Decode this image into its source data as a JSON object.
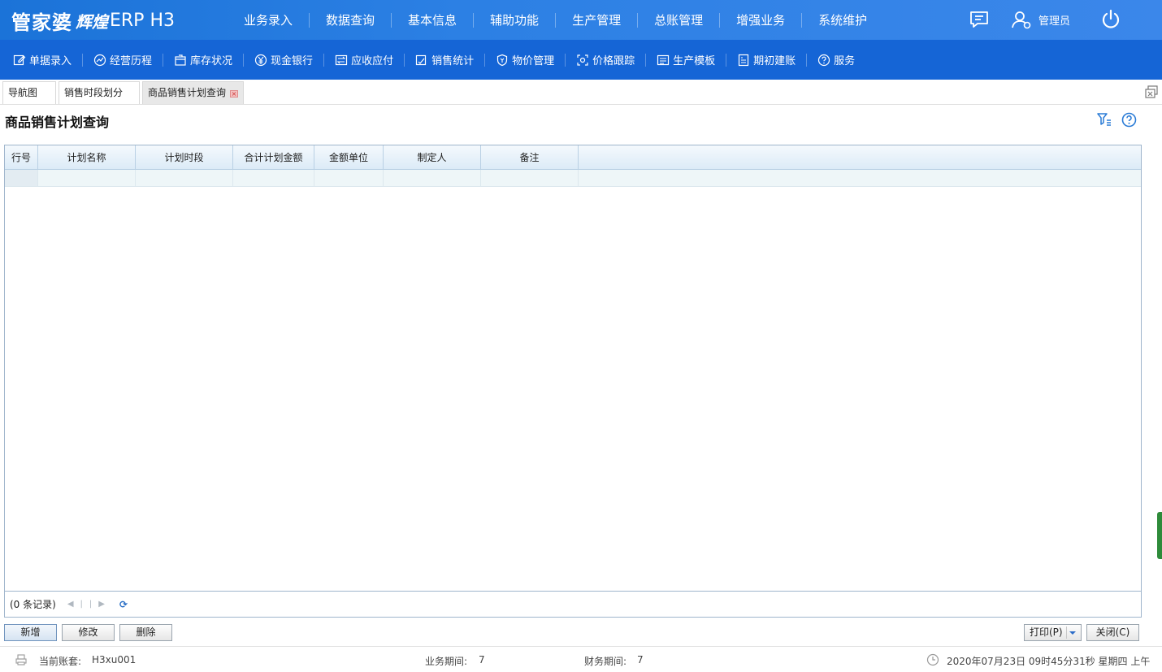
{
  "app": {
    "brand": "管家婆",
    "sub": "辉煌",
    "product": "ERP H3"
  },
  "topnav": {
    "items": [
      "业务录入",
      "数据查询",
      "基本信息",
      "辅助功能",
      "生产管理",
      "总账管理",
      "增强业务",
      "系统维护"
    ],
    "user": "管理员"
  },
  "toolbar": {
    "items": [
      "单据录入",
      "经营历程",
      "库存状况",
      "现金银行",
      "应收应付",
      "销售统计",
      "物价管理",
      "价格跟踪",
      "生产模板",
      "期初建账",
      "服务"
    ]
  },
  "tabs": [
    {
      "label": "导航图"
    },
    {
      "label": "销售时段划分"
    },
    {
      "label": "商品销售计划查询"
    }
  ],
  "page": {
    "title": "商品销售计划查询"
  },
  "grid": {
    "columns": [
      "行号",
      "计划名称",
      "计划时段",
      "合计计划金额",
      "金额单位",
      "制定人",
      "备注"
    ],
    "record_count": "(0 条记录)"
  },
  "buttons": {
    "add": "新增",
    "edit": "修改",
    "delete": "删除",
    "print": "打印(P)",
    "close": "关闭(C)"
  },
  "status": {
    "account_label": "当前账套:",
    "account_value": "H3xu001",
    "biz_period_label": "业务期间:",
    "biz_period_value": "7",
    "fin_period_label": "财务期间:",
    "fin_period_value": "7",
    "datetime": "2020年07月23日 09时45分31秒 星期四 上午"
  },
  "colors": {
    "topbar": "#2c80e4",
    "toolbar": "#1565d6",
    "grid_header": "#dcebf7"
  }
}
